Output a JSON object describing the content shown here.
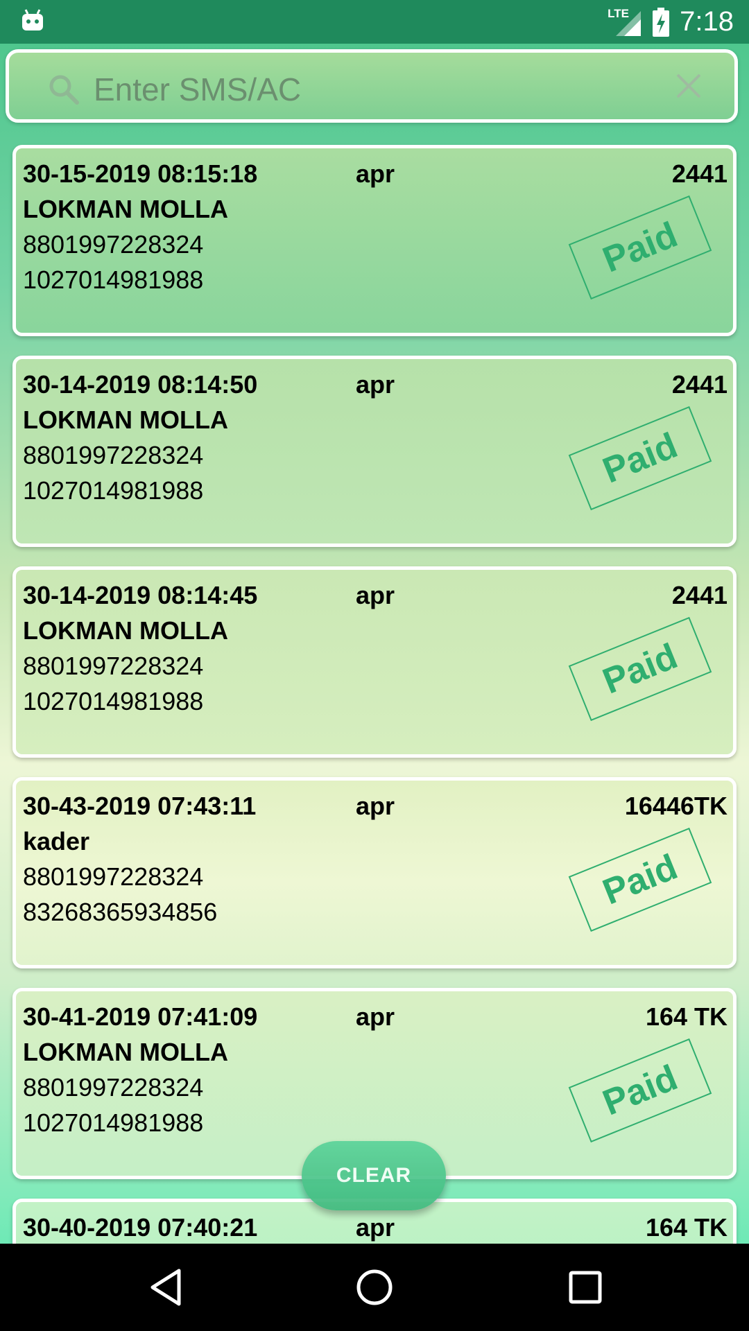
{
  "status_bar": {
    "network": "LTE",
    "time": "7:18"
  },
  "search": {
    "placeholder": "Enter SMS/AC"
  },
  "records": [
    {
      "datetime": "30-15-2019 08:15:18",
      "month": "apr",
      "amount": "2441",
      "name": "LOKMAN MOLLA",
      "phone": "8801997228324",
      "account": "1027014981988",
      "status": "Paid"
    },
    {
      "datetime": "30-14-2019 08:14:50",
      "month": "apr",
      "amount": "2441",
      "name": "LOKMAN MOLLA",
      "phone": "8801997228324",
      "account": "1027014981988",
      "status": "Paid"
    },
    {
      "datetime": "30-14-2019 08:14:45",
      "month": "apr",
      "amount": "2441",
      "name": "LOKMAN MOLLA",
      "phone": "8801997228324",
      "account": "1027014981988",
      "status": "Paid"
    },
    {
      "datetime": "30-43-2019 07:43:11",
      "month": "apr",
      "amount": "16446TK",
      "name": "kader",
      "phone": "8801997228324",
      "account": "83268365934856",
      "status": "Paid"
    },
    {
      "datetime": "30-41-2019 07:41:09",
      "month": "apr",
      "amount": "164 TK",
      "name": "LOKMAN MOLLA",
      "phone": "8801997228324",
      "account": "1027014981988",
      "status": "Paid"
    },
    {
      "datetime": "30-40-2019 07:40:21",
      "month": "apr",
      "amount": "164 TK"
    }
  ],
  "clear_button": {
    "label": "CLEAR"
  },
  "colors": {
    "status_bar": "#1f8a5c",
    "stamp": "#2fae6f",
    "clear_button": "#4cc58b"
  }
}
